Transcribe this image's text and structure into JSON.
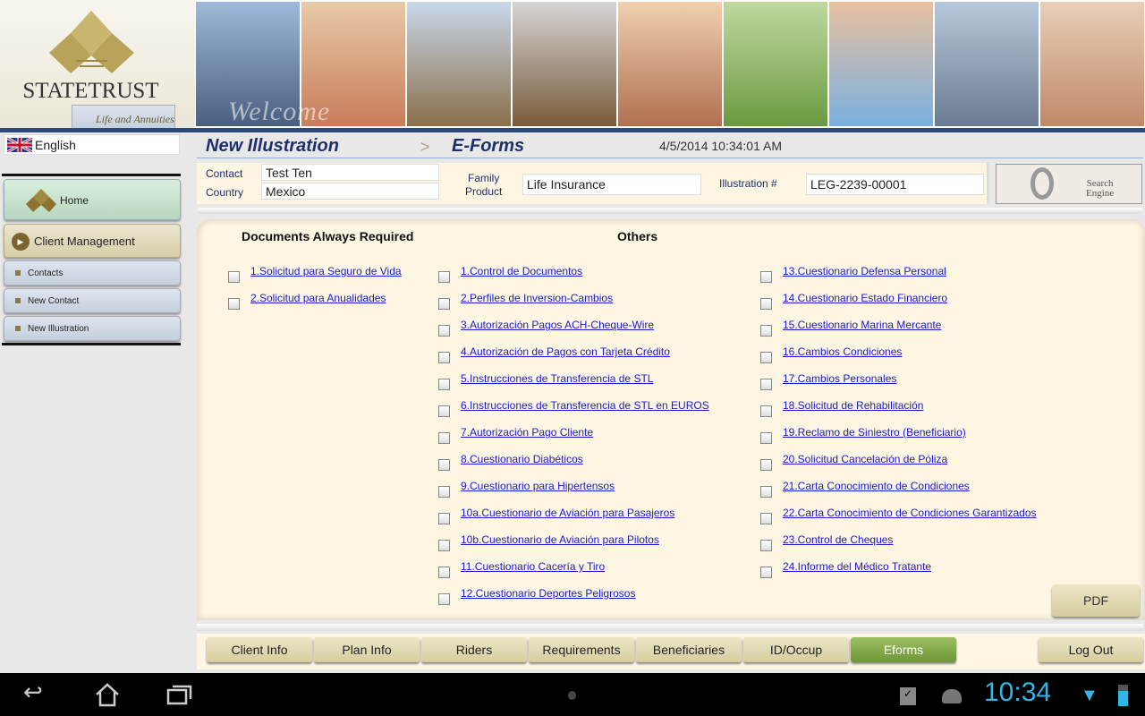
{
  "header": {
    "brand": "STATETRUST",
    "tagline": "Life and Annuities",
    "welcome": "Welcome"
  },
  "sidebar": {
    "language": "English",
    "home": "Home",
    "client_management": "Client Management",
    "items": [
      "Contacts",
      "New Contact",
      "New Illustration"
    ]
  },
  "breadcrumb": {
    "first": "New Illustration",
    "separator": ">",
    "second": "E-Forms"
  },
  "datetime": "4/5/2014 10:34:01 AM",
  "info": {
    "contact_label": "Contact",
    "contact_value": "Test Ten",
    "country_label": "Country",
    "country_value": "Mexico",
    "family_product_label_1": "Family",
    "family_product_label_2": "Product",
    "family_product_value": "Life Insurance",
    "illustration_label": "Illustration #",
    "illustration_value": "LEG-2239-00001"
  },
  "search": {
    "line1": "Search",
    "line2": "Engine"
  },
  "forms": {
    "required_title": "Documents Always Required",
    "others_title": "Others",
    "required": [
      "1.Solicitud para Seguro de Vida",
      "2.Solicitud para Anualidades"
    ],
    "others_col1": [
      "1.Control de Documentos",
      "2.Perfiles de Inversion-Cambios",
      "3.Autorización Pagos ACH-Cheque-Wire",
      "4.Autorización de Pagos con Tarjeta Crédito ",
      "5.Instrucciones de Transferencia de STL",
      "6.Instrucciones de Transferencia de STL en EUROS",
      "7.Autorización Pago Cliente",
      "8.Cuestionario Diabéticos",
      "9.Cuestionario para Hipertensos",
      "10a.Cuestionario de Aviación para Pasajeros ",
      "10b.Cuestionario de Aviación para Pilotos",
      "11.Cuestionario Cacería y Tiro",
      "12.Cuestionario Deportes Peligrosos"
    ],
    "others_col2": [
      "13.Cuestionario Defensa Personal",
      "14.Cuestionario Estado Financiero",
      "15.Cuestionario Marina Mercante",
      "16.Cambios Condiciones",
      "17.Cambios Personales",
      "18.Solicitud de Rehabilitación",
      "19.Reclamo de Siniestro (Beneficiario)",
      "20.Solicitud Cancelación de Póliza",
      "21.Carta Conocimiento de Condiciones",
      "22.Carta Conocimiento de Condiciones Garantizados",
      "23.Control de Cheques",
      "24.Informe del Médico Tratante"
    ]
  },
  "pdf": "PDF",
  "tabs": [
    "Client Info",
    "Plan Info",
    "Riders",
    "Requirements",
    "Beneficiaries",
    "ID/Occup",
    "Eforms"
  ],
  "active_tab": "Eforms",
  "logout": "Log Out",
  "system": {
    "clock": "10:34"
  },
  "colors": {
    "accent": "#1f2f6e",
    "link": "#1a1ad6",
    "active_tab": "#7fa545",
    "clock": "#33b5e5"
  }
}
